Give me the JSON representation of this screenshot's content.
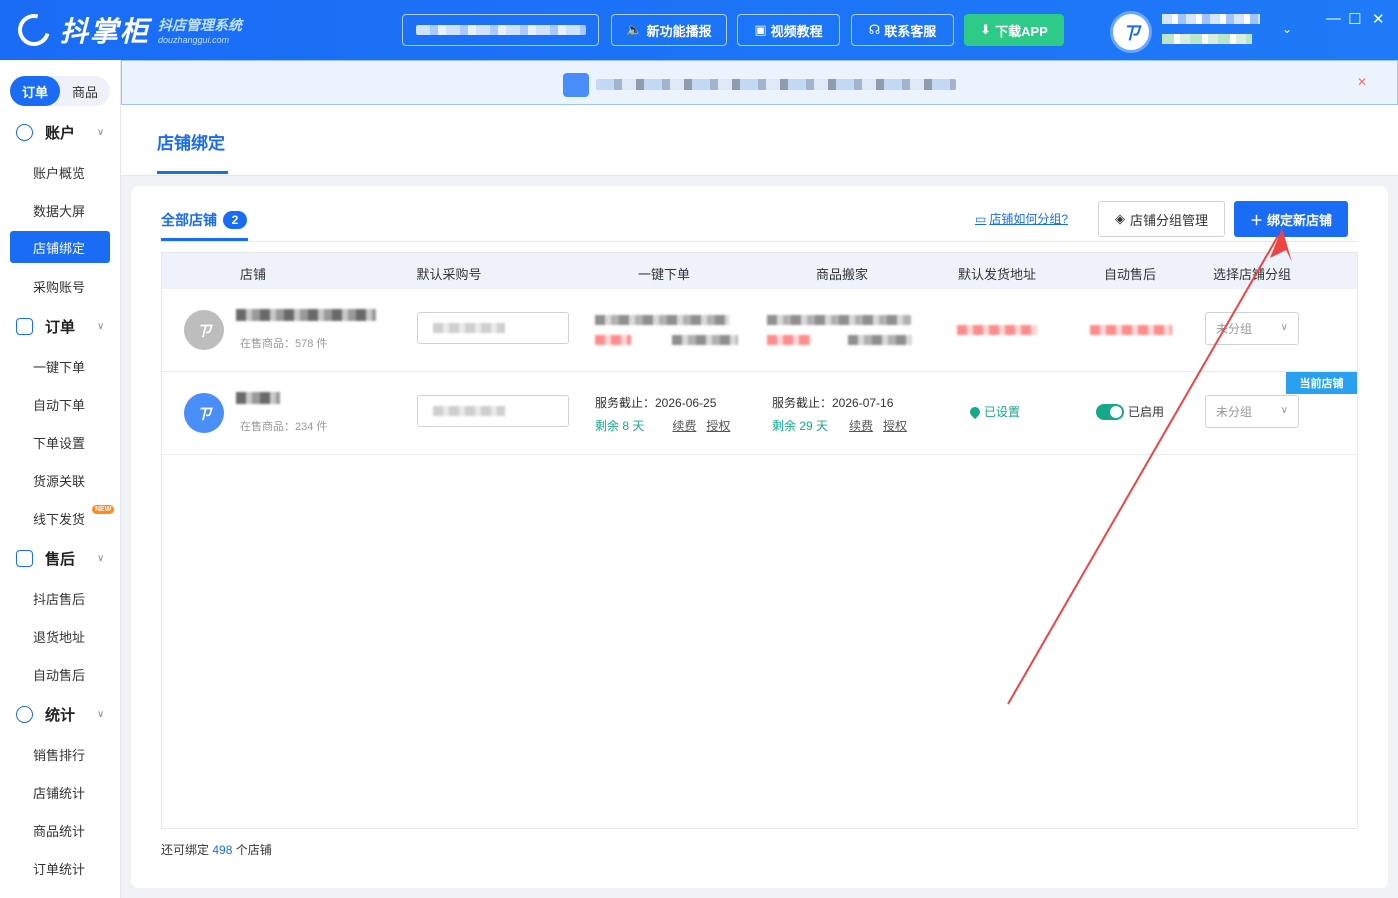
{
  "app": {
    "title": "抖掌柜",
    "subtitle": "抖店管理系统",
    "domain": "douzhanggui.com"
  },
  "topbar": {
    "buttons": [
      {
        "label": "新功能播报",
        "icon": "speaker-icon"
      },
      {
        "label": "视频教程",
        "icon": "video-icon"
      },
      {
        "label": "联系客服",
        "icon": "headset-icon"
      },
      {
        "label": "下载APP",
        "icon": "download-icon"
      }
    ],
    "window_controls": [
      "—",
      "☐",
      "✕"
    ]
  },
  "sidebar": {
    "segments": [
      "订单",
      "商品"
    ],
    "groups": [
      {
        "label": "账户",
        "icon": "account-icon",
        "items": [
          "账户概览",
          "数据大屏",
          "店铺绑定",
          "采购账号"
        ]
      },
      {
        "label": "订单",
        "icon": "order-icon",
        "items": [
          "一键下单",
          "自动下单",
          "下单设置",
          "货源关联",
          "线下发货"
        ]
      },
      {
        "label": "售后",
        "icon": "aftersale-icon",
        "items": [
          "抖店售后",
          "退货地址",
          "自动售后"
        ]
      },
      {
        "label": "统计",
        "icon": "stats-icon",
        "items": [
          "销售排行",
          "店铺统计",
          "商品统计",
          "订单统计"
        ]
      }
    ],
    "active_item": "店铺绑定",
    "new_badge": "NEW"
  },
  "page": {
    "title": "店铺绑定"
  },
  "panel": {
    "tab_label": "全部店铺",
    "tab_count": "2",
    "help_link": "店铺如何分组?",
    "group_button": "店铺分组管理",
    "bind_button": "绑定新店铺",
    "columns": [
      "店铺",
      "默认采购号",
      "一键下单",
      "商品搬家",
      "默认发货地址",
      "自动售后",
      "选择店铺分组"
    ],
    "rows": [
      {
        "onsale": "在售商品：578 件",
        "group": "未分组"
      },
      {
        "onsale": "在售商品：234 件",
        "order_service": "服务截止：2026-06-25",
        "order_remaining": "剩余 8 天",
        "move_service": "服务截止：2026-07-16",
        "move_remaining": "剩余 29 天",
        "renew": "续费",
        "auth": "授权",
        "address": "已设置",
        "auto_aftersale": "已启用",
        "group": "未分组",
        "current_tag": "当前店铺"
      }
    ],
    "footer_prefix": "还可绑定",
    "footer_count": "498",
    "footer_suffix": "个店铺"
  },
  "colors": {
    "primary": "#1a6cf5",
    "success": "#17a889",
    "download": "#2ecb88",
    "annotation_arrow": "#ef4444"
  }
}
